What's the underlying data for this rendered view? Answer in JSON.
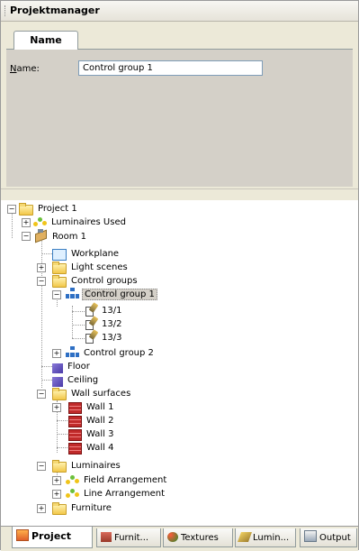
{
  "panel": {
    "title": "Projektmanager"
  },
  "properties": {
    "tab_label": "Name",
    "name_label_underlined": "N",
    "name_label_rest": "ame:",
    "name_value": "Control group 1"
  },
  "tree": {
    "project": "Project 1",
    "luminaires_used": "Luminaires Used",
    "room": "Room 1",
    "workplane": "Workplane",
    "light_scenes": "Light scenes",
    "control_groups": "Control groups",
    "control_group_1": "Control group 1",
    "fixture_1": "13/1",
    "fixture_2": "13/2",
    "fixture_3": "13/3",
    "control_group_2": "Control group 2",
    "floor": "Floor",
    "ceiling": "Ceiling",
    "wall_surfaces": "Wall surfaces",
    "wall_1": "Wall 1",
    "wall_2": "Wall 2",
    "wall_3": "Wall 3",
    "wall_4": "Wall 4",
    "luminaires": "Luminaires",
    "field_arrangement": "Field Arrangement",
    "line_arrangement": "Line Arrangement",
    "furniture": "Furniture",
    "expand_glyph": "+",
    "collapse_glyph": "−"
  },
  "bottom_tabs": {
    "project": "Project",
    "furniture": "Furnit...",
    "textures": "Textures",
    "luminaires": "Lumin...",
    "output": "Output"
  },
  "icons": {
    "folder": "folder-icon",
    "luminaires": "luminaires-icon",
    "room": "room-icon",
    "workplane": "workplane-icon",
    "control_group": "control-group-icon",
    "fixture": "fixture-icon",
    "surface": "surface-icon",
    "wall": "wall-icon"
  },
  "colors": {
    "selection_bg": "#d4d0c8",
    "panel_bg": "#ece9d8",
    "wall_red": "#c02a2a"
  }
}
